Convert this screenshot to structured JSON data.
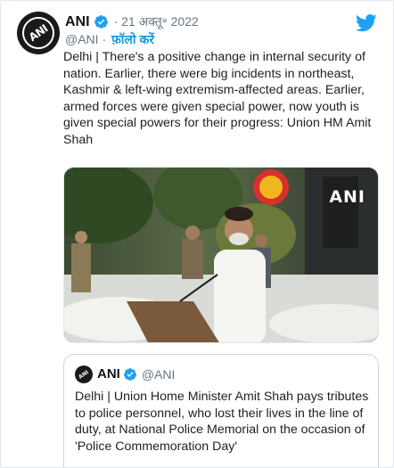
{
  "tweet": {
    "author": {
      "display_name": "ANI",
      "handle": "@ANI",
      "avatar_text": "ANI",
      "verified": true
    },
    "timestamp": "21 अक्तू॰ 2022",
    "separator": "·",
    "follow_label": "फ़ॉलो करें",
    "text": "Delhi | There's a positive change in internal security of nation. Earlier, there were big incidents in northeast, Kashmir & left-wing extremism-affected areas. Earlier, armed forces were given special power, now youth is given special powers for their progress: Union HM Amit Shah",
    "media": {
      "watermark": "ANI"
    }
  },
  "quoted_tweet": {
    "author": {
      "display_name": "ANI",
      "handle": "@ANI",
      "avatar_text": "ANI",
      "verified": true
    },
    "text": "Delhi | Union Home Minister Amit Shah pays tributes to police personnel, who lost their lives in the line of duty, at National Police Memorial on the occasion of 'Police Commemoration Day'"
  },
  "colors": {
    "accent": "#1da1f2",
    "follow": "#1b95e0",
    "muted": "#657786",
    "text": "#1c2022",
    "border": "#ccd6dd"
  },
  "icons": {
    "brand": "twitter-bird-icon",
    "verified": "verified-badge-icon"
  }
}
